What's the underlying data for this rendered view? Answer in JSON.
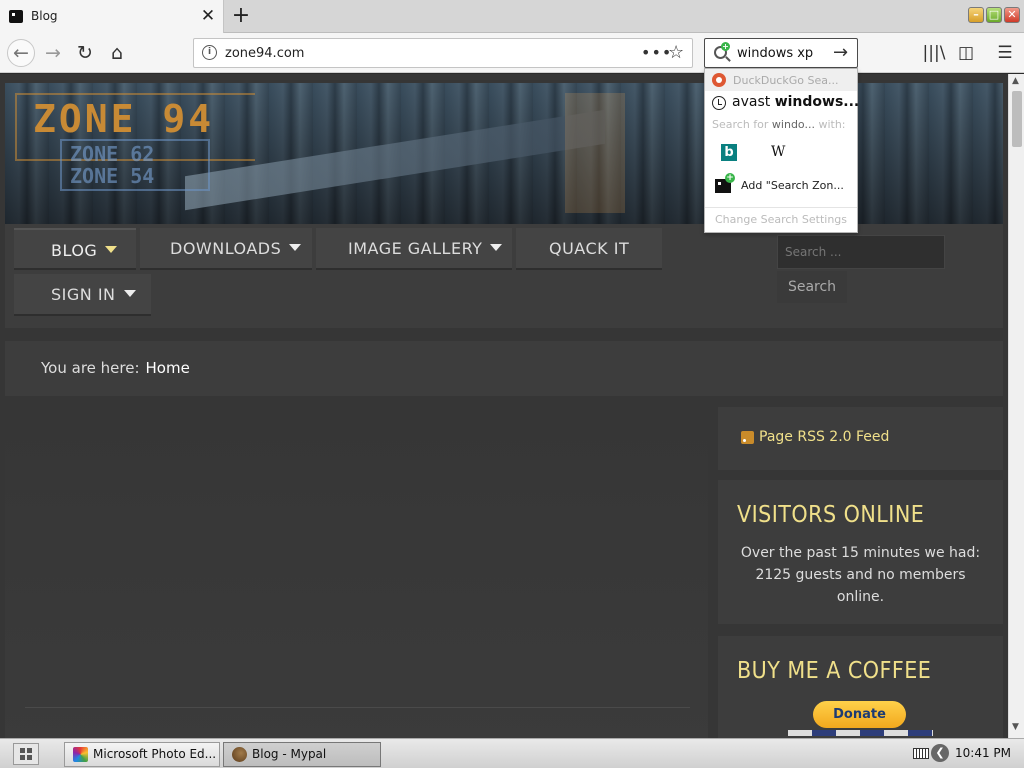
{
  "browser": {
    "tab": {
      "title": "Blog",
      "close": "✕",
      "favicon": "zone94-favicon-icon"
    },
    "new_tab": "+",
    "window_controls": {
      "minimize": "–",
      "maximize": "□",
      "close": "✕"
    },
    "nav": {
      "back": "←",
      "forward": "→",
      "reload": "↻",
      "home": "⌂"
    },
    "url": {
      "info": "i",
      "value": "zone94.com",
      "page_actions": "•••",
      "bookmark": "☆"
    },
    "search": {
      "value": "windows xp",
      "go": "→"
    },
    "toolbar": {
      "library": "|||\\",
      "sidebar": "◫",
      "menu": "☰"
    }
  },
  "search_dropdown": {
    "header": "DuckDuckGo Sea...",
    "suggestion_prefix": "avast ",
    "suggestion_bold": "windows...",
    "search_for_prefix": "Search for ",
    "search_for_query": "windo...",
    "search_for_suffix": " with:",
    "engines": [
      {
        "name": "bing-icon",
        "glyph": "b"
      },
      {
        "name": "wikipedia-icon",
        "glyph": "W"
      }
    ],
    "add_engine": "Add \"Search Zon...",
    "settings": "Change Search Settings"
  },
  "site": {
    "logo": {
      "main": "ZONE 94",
      "sub1": "ZONE 62",
      "sub2": "ZONE 54"
    },
    "menu": [
      {
        "label": "BLOG"
      },
      {
        "label": "DOWNLOADS"
      },
      {
        "label": "IMAGE GALLERY"
      },
      {
        "label": "QUACK IT"
      },
      {
        "label": "SIGN IN"
      }
    ],
    "search": {
      "placeholder": "Search ...",
      "button": "Search"
    },
    "breadcrumb": {
      "prefix": "You are here:",
      "current": "Home"
    },
    "sidebar": {
      "rss": "Page RSS 2.0 Feed",
      "visitors_title": "VISITORS ONLINE",
      "visitors_text": "Over the past 15 minutes we had: 2125 guests and no members online.",
      "coffee_title": "BUY ME A COFFEE",
      "donate": "Donate"
    }
  },
  "taskbar": {
    "tasks": [
      {
        "label": "Microsoft Photo Ed...",
        "icon": "photo-editor-icon"
      },
      {
        "label": "Blog - Mypal",
        "icon": "mypal-icon"
      }
    ],
    "tray_arrow": "❮",
    "clock": "10:41 PM"
  },
  "colors": {
    "accent": "#f0e08a",
    "page_bg": "#363636",
    "panel_bg": "#3d3d3d",
    "logo": "#c88a35"
  }
}
